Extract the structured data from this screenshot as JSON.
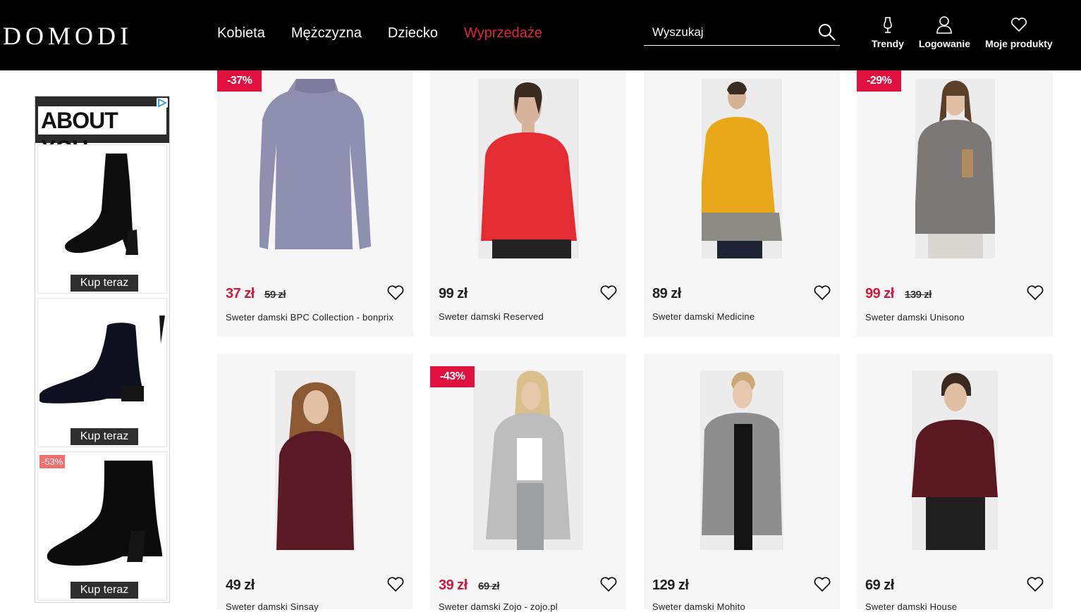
{
  "header": {
    "logo": "DOMODI",
    "nav": [
      "Kobieta",
      "Mężczyzna",
      "Dziecko",
      "Wyprzedaże"
    ],
    "search": {
      "placeholder": "Wyszukaj"
    },
    "actions": [
      "Trendy",
      "Logowanie",
      "Moje produkty"
    ]
  },
  "ad": {
    "brand": "ABOUT YOU",
    "buy_label": "Kup teraz",
    "third_badge": "-53%"
  },
  "products": [
    {
      "badge": "-37%",
      "price": "37 zł",
      "old_price": "59 zł",
      "title": "Sweter damski BPC Collection - bonprix"
    },
    {
      "badge": "",
      "price": "99 zł",
      "old_price": "",
      "title": "Sweter damski Reserved"
    },
    {
      "badge": "",
      "price": "89 zł",
      "old_price": "",
      "title": "Sweter damski Medicine"
    },
    {
      "badge": "-29%",
      "price": "99 zł",
      "old_price": "139 zł",
      "title": "Sweter damski Unisono"
    },
    {
      "badge": "",
      "price": "49 zł",
      "old_price": "",
      "title": "Sweter damski Sinsay"
    },
    {
      "badge": "-43%",
      "price": "39 zł",
      "old_price": "69 zł",
      "title": "Sweter damski Zojo - zojo.pl"
    },
    {
      "badge": "",
      "price": "129 zł",
      "old_price": "",
      "title": "Sweter damski Mohito"
    },
    {
      "badge": "",
      "price": "69 zł",
      "old_price": "",
      "title": "Sweter damski House"
    }
  ],
  "colors": {
    "header_bg": "#000000",
    "sale_red": "#e0113f",
    "price_sale": "#d01a3d",
    "card_bg": "#f6f6f6"
  }
}
